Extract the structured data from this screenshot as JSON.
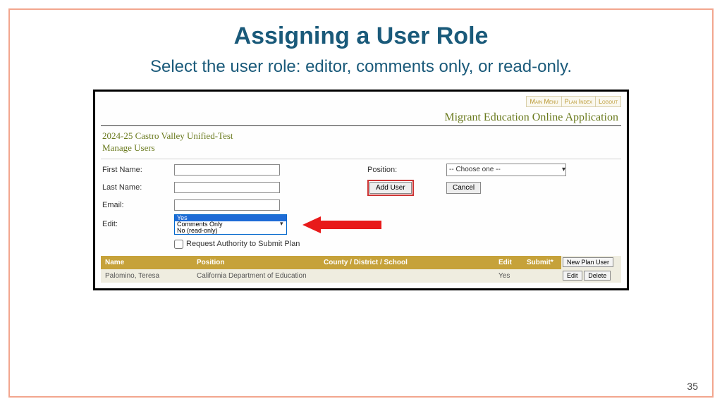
{
  "slide": {
    "title": "Assigning a User Role",
    "subtitle": "Select the user role: editor, comments only, or read-only.",
    "page_number": "35"
  },
  "topnav": {
    "main": "Main Menu",
    "plan": "Plan Index",
    "logout": "Logout"
  },
  "app": {
    "title": "Migrant Education Online Application",
    "context_line1": "2024-25 Castro Valley Unified-Test",
    "context_line2": "Manage Users"
  },
  "form": {
    "first_name_label": "First Name:",
    "last_name_label": "Last Name:",
    "email_label": "Email:",
    "edit_label": "Edit:",
    "position_label": "Position:",
    "position_placeholder": "-- Choose one --",
    "add_user": "Add User",
    "cancel": "Cancel",
    "request_authority": "Request Authority to Submit Plan",
    "edit_options": {
      "yes": "Yes",
      "comments": "Comments Only",
      "readonly": "No (read-only)"
    }
  },
  "table": {
    "headers": {
      "name": "Name",
      "position": "Position",
      "cds": "County / District / School",
      "edit": "Edit",
      "submit": "Submit*",
      "new_plan": "New Plan User"
    },
    "row": {
      "name": "Palomino, Teresa",
      "position": "California Department of Education",
      "cds": "",
      "edit": "Yes",
      "submit": ""
    },
    "actions": {
      "edit": "Edit",
      "delete": "Delete"
    }
  }
}
